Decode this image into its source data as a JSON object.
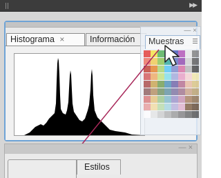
{
  "tabs": {
    "histogram": "Histograma",
    "info": "Información",
    "swatches": "Muestras",
    "close_glyph": "×"
  },
  "lower_panel": {
    "tab": "Estilos"
  },
  "colors": {
    "panel_border": "#6ea3d6",
    "histogram_fill": "#000000",
    "pointer_line": "#a8285a"
  },
  "icons": {
    "collapse": "panel-grip-icon",
    "expand": "expand-panels-icon",
    "cursor": "arrow-cursor-icon",
    "menu": "panel-menu-icon"
  }
}
